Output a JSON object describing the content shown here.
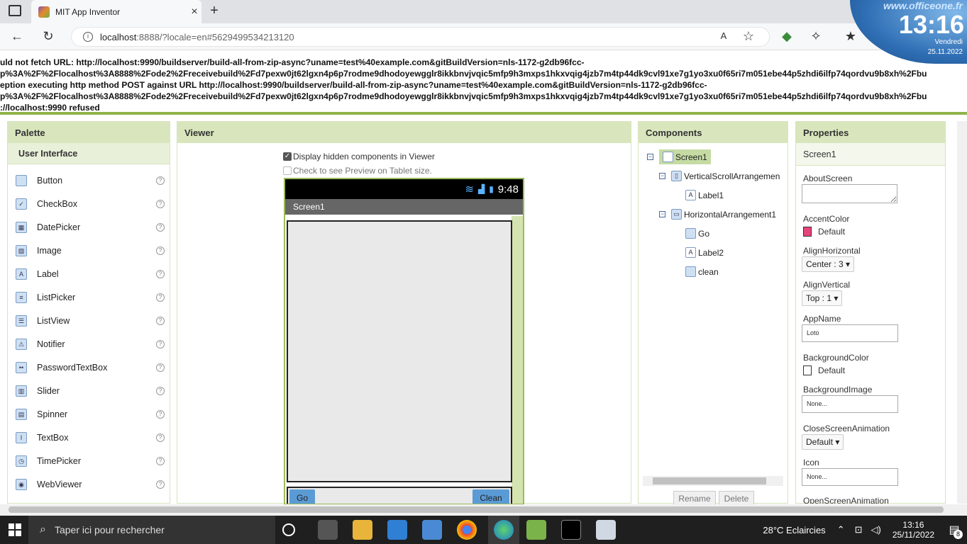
{
  "browser": {
    "tab_title": "MIT App Inventor",
    "url_host": "localhost",
    "url_rest": ":8888/?locale=en#5629499534213120"
  },
  "clock": {
    "site": "www.officeone.fr",
    "time": "13:16",
    "day": "Vendredi",
    "date": "25.11.2022"
  },
  "error_lines": [
    "uld not fetch URL: http://localhost:9990/buildserver/build-all-from-zip-async?uname=test%40example.com&gitBuildVersion=nls-1172-g2db96fcc-",
    "p%3A%2F%2Flocalhost%3A8888%2Fode2%2Freceivebuild%2Fd7pexw0jt62lgxn4p6p7rodme9dhodoyewgglr8ikkbnvjvqic5mfp9h3mxps1hkxvqig4jzb7m4tp44dk9cvl91xe7g1yo3xu0f65ri7m051ebe44p5zhdi6ilfp74qordvu9b8xh%2Fbu",
    "eption executing http method POST against URL http://localhost:9990/buildserver/build-all-from-zip-async?uname=test%40example.com&gitBuildVersion=nls-1172-g2db96fcc-",
    "p%3A%2F%2Flocalhost%3A8888%2Fode2%2Freceivebuild%2Fd7pexw0jt62lgxn4p6p7rodme9dhodoyewgglr8ikkbnvjvqic5mfp9h3mxps1hkxvqig4jzb7m4tp44dk9cvl91xe7g1yo3xu0f65ri7m051ebe44p5zhdi6ilfp74qordvu9b8xh%2Fbu",
    "://localhost:9990 refused"
  ],
  "palette": {
    "title": "Palette",
    "section": "User Interface",
    "items": [
      "Button",
      "CheckBox",
      "DatePicker",
      "Image",
      "Label",
      "ListPicker",
      "ListView",
      "Notifier",
      "PasswordTextBox",
      "Slider",
      "Spinner",
      "TextBox",
      "TimePicker",
      "WebViewer"
    ],
    "help": "?"
  },
  "viewer": {
    "title": "Viewer",
    "display_hidden": "Display hidden components in Viewer",
    "tablet_preview": "Check to see Preview on Tablet size.",
    "phone_time": "9:48",
    "screen_title": "Screen1",
    "go_label": "Go",
    "clean_label": "Clean"
  },
  "components": {
    "title": "Components",
    "tree": [
      "Screen1",
      "VerticalScrollArrangemen",
      "Label1",
      "HorizontalArrangement1",
      "Go",
      "Label2",
      "clean"
    ],
    "rename": "Rename",
    "delete": "Delete"
  },
  "properties": {
    "title": "Properties",
    "screen": "Screen1",
    "about_label": "AboutScreen",
    "accent_label": "AccentColor",
    "accent_value": "Default",
    "accent_color": "#e8437a",
    "alignh_label": "AlignHorizontal",
    "alignh_value": "Center : 3 ▾",
    "alignv_label": "AlignVertical",
    "alignv_value": "Top : 1 ▾",
    "appname_label": "AppName",
    "appname_value": "Loto",
    "bgcolor_label": "BackgroundColor",
    "bgcolor_value": "Default",
    "bgimage_label": "BackgroundImage",
    "bgimage_value": "None...",
    "close_anim_label": "CloseScreenAnimation",
    "close_anim_value": "Default ▾",
    "icon_label": "Icon",
    "icon_value": "None...",
    "open_anim_label": "OpenScreenAnimation"
  },
  "taskbar": {
    "search_placeholder": "Taper ici pour rechercher",
    "weather": "28°C  Eclaircies",
    "time": "13:16",
    "date": "25/11/2022",
    "notif_count": "8"
  }
}
